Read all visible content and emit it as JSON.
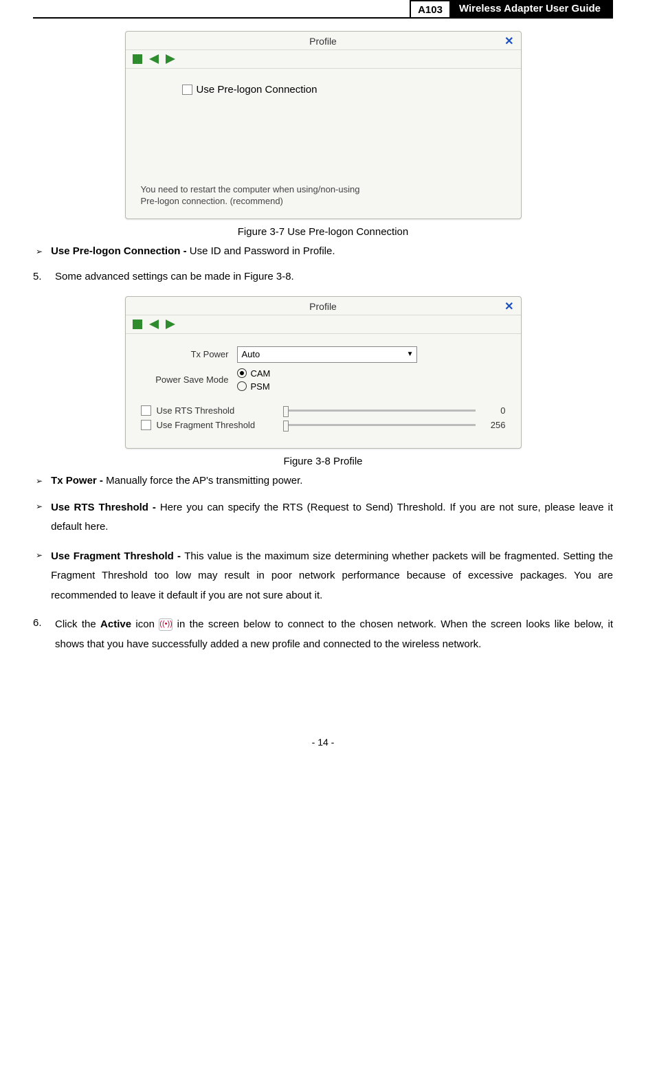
{
  "header": {
    "model": "A103",
    "title": "Wireless Adapter User Guide"
  },
  "panel1": {
    "title": "Profile",
    "checkbox_label": "Use Pre-logon Connection",
    "note1": "You need to restart the computer when using/non-using",
    "note2": "Pre-logon connection. (recommend)"
  },
  "caption1": "Figure 3-7 Use Pre-logon Connection",
  "bullet1": {
    "label": "Use Pre-logon Connection - ",
    "text": "Use ID and Password in Profile."
  },
  "step5": {
    "num": "5.",
    "text": "Some advanced settings can be made in Figure 3-8."
  },
  "panel2": {
    "title": "Profile",
    "tx_power_label": "Tx Power",
    "tx_power_value": "Auto",
    "psm_label": "Power Save Mode",
    "radio_cam": "CAM",
    "radio_psm": "PSM",
    "rts_label": "Use RTS Threshold",
    "rts_value": "0",
    "frag_label": "Use Fragment Threshold",
    "frag_value": "256"
  },
  "caption2": "Figure 3-8 Profile",
  "bullet_tx": {
    "label": "Tx Power - ",
    "text": "Manually force the AP's transmitting power."
  },
  "bullet_rts": {
    "label": "Use RTS Threshold - ",
    "text": "Here you can specify the RTS (Request to Send) Threshold. If you are not sure, please leave it default here."
  },
  "bullet_frag": {
    "label": "Use Fragment Threshold - ",
    "text": "This value is the maximum size determining whether packets will be fragmented. Setting the Fragment Threshold too low may result in poor network performance because of excessive packages. You are recommended to leave it default if you are not sure about it."
  },
  "step6": {
    "num": "6.",
    "t1": "Click the ",
    "bold": "Active",
    "t2": " icon ",
    "t3": " in the screen below to connect to the chosen network. When the screen looks like below, it shows that you have successfully added a new profile and connected to the wireless network."
  },
  "page_number": "- 14 -",
  "glyphs": {
    "tri": "➢",
    "antenna": "((•))"
  }
}
